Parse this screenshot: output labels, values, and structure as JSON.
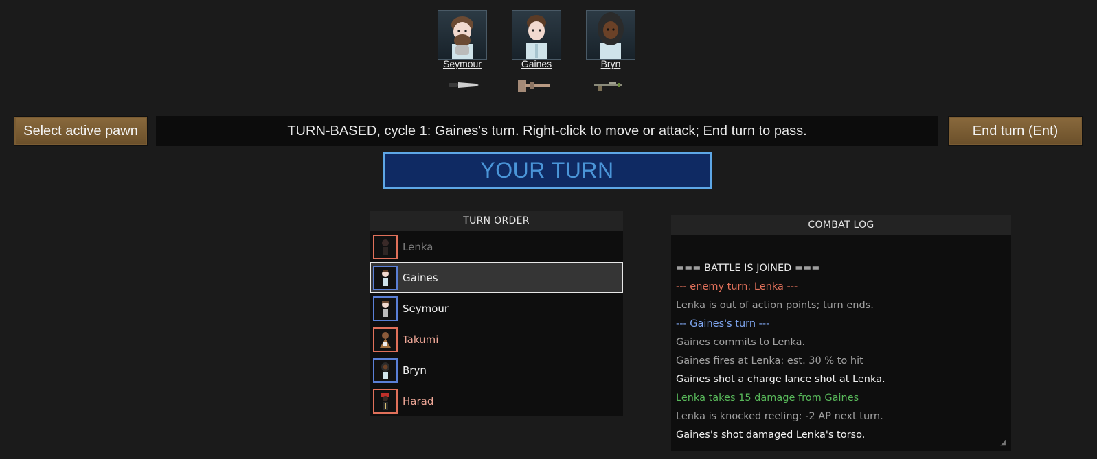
{
  "colleagues": [
    {
      "name": "Seymour",
      "weapon_icon": "knife-icon"
    },
    {
      "name": "Gaines",
      "weapon_icon": "charge-lance-icon"
    },
    {
      "name": "Bryn",
      "weapon_icon": "rifle-icon"
    }
  ],
  "controls": {
    "select_pawn_label": "Select active pawn",
    "end_turn_label": "End turn (Ent)"
  },
  "status": "TURN-BASED, cycle 1: Gaines's turn. Right-click to move or attack; End turn to pass.",
  "banner": "YOUR TURN",
  "turn_order": {
    "title": "TURN ORDER",
    "entries": [
      {
        "name": "Lenka",
        "side": "enemy",
        "state": "done"
      },
      {
        "name": "Gaines",
        "side": "ally",
        "state": "active"
      },
      {
        "name": "Seymour",
        "side": "ally",
        "state": "waiting"
      },
      {
        "name": "Takumi",
        "side": "enemy",
        "state": "waiting"
      },
      {
        "name": "Bryn",
        "side": "ally",
        "state": "waiting"
      },
      {
        "name": "Harad",
        "side": "enemy",
        "state": "waiting"
      }
    ]
  },
  "combat_log": {
    "title": "COMBAT LOG",
    "lines": [
      {
        "text": "=== BATTLE IS JOINED ===",
        "color": "#e9e9e9"
      },
      {
        "text": "--- enemy turn: Lenka ---",
        "color": "#e0705a"
      },
      {
        "text": "Lenka is out of action points; turn ends.",
        "color": "#a0a0a0"
      },
      {
        "text": "--- Gaines's turn ---",
        "color": "#7fa6f0"
      },
      {
        "text": "Gaines commits to Lenka.",
        "color": "#a0a0a0"
      },
      {
        "text": "Gaines fires at Lenka: est. 30 % to hit",
        "color": "#a0a0a0"
      },
      {
        "text": "Gaines shot a charge lance shot at Lenka.",
        "color": "#f0f0f0"
      },
      {
        "text": "Lenka takes 15 damage from Gaines",
        "color": "#58b85a"
      },
      {
        "text": "Lenka is knocked reeling: -2 AP next turn.",
        "color": "#a0a0a0"
      },
      {
        "text": "Gaines's shot damaged Lenka's torso.",
        "color": "#f0f0f0"
      }
    ]
  },
  "colors": {
    "ally": "#5a7fd6",
    "enemy": "#e0705a",
    "banner_bg": "#0f2a63",
    "banner_text": "#4a95d8",
    "button_bg": "#7a5c33"
  }
}
